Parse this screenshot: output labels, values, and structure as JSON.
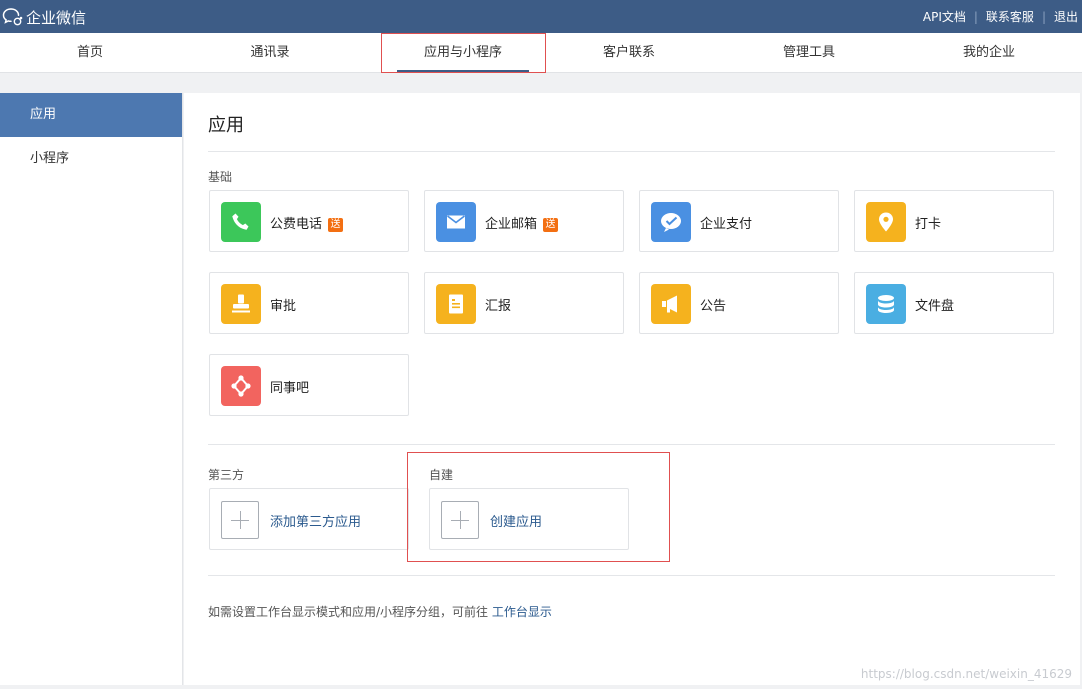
{
  "brand": {
    "name": "企业微信"
  },
  "top_links": {
    "api_docs": "API文档",
    "support": "联系客服",
    "logout": "退出",
    "separator": "|"
  },
  "nav": {
    "items": [
      {
        "label": "首页"
      },
      {
        "label": "通讯录"
      },
      {
        "label": "应用与小程序",
        "active": true
      },
      {
        "label": "客户联系"
      },
      {
        "label": "管理工具"
      },
      {
        "label": "我的企业"
      }
    ]
  },
  "sidebar": {
    "items": [
      {
        "label": "应用",
        "active": true
      },
      {
        "label": "小程序"
      }
    ]
  },
  "main": {
    "title": "应用",
    "basic_label": "基础",
    "apps": [
      {
        "label": "公费电话",
        "badge": "送",
        "icon": "phone-icon",
        "color": "#3cc75a"
      },
      {
        "label": "企业邮箱",
        "badge": "送",
        "icon": "mail-icon",
        "color": "#4a90e2"
      },
      {
        "label": "企业支付",
        "badge": "",
        "icon": "payment-icon",
        "color": "#4a90e2"
      },
      {
        "label": "打卡",
        "badge": "",
        "icon": "location-pin-icon",
        "color": "#f5b21e"
      },
      {
        "label": "审批",
        "badge": "",
        "icon": "stamp-icon",
        "color": "#f5b21e"
      },
      {
        "label": "汇报",
        "badge": "",
        "icon": "report-icon",
        "color": "#f5b21e"
      },
      {
        "label": "公告",
        "badge": "",
        "icon": "megaphone-icon",
        "color": "#f5b21e"
      },
      {
        "label": "文件盘",
        "badge": "",
        "icon": "database-icon",
        "color": "#4aaee2"
      },
      {
        "label": "同事吧",
        "badge": "",
        "icon": "network-icon",
        "color": "#f2645f"
      }
    ],
    "third_party_label": "第三方",
    "third_party_add": "添加第三方应用",
    "self_built_label": "自建",
    "self_built_create": "创建应用",
    "tip_text": "如需设置工作台显示模式和应用/小程序分组，可前往",
    "tip_link": "工作台显示"
  },
  "watermark": "https://blog.csdn.net/weixin_41629"
}
